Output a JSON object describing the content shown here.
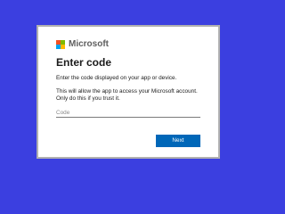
{
  "brand": {
    "name": "Microsoft",
    "logo_colors": [
      "#f25022",
      "#7fba00",
      "#00a4ef",
      "#ffb900"
    ]
  },
  "dialog": {
    "title": "Enter code",
    "description": "Enter the code displayed on your app or device.",
    "warning": "This will allow the app to access your Microsoft account. Only do this if you trust it.",
    "code_input": {
      "placeholder": "Code",
      "value": ""
    },
    "next_label": "Next"
  },
  "colors": {
    "background": "#3b3fe0",
    "primary_button": "#0067b8"
  }
}
